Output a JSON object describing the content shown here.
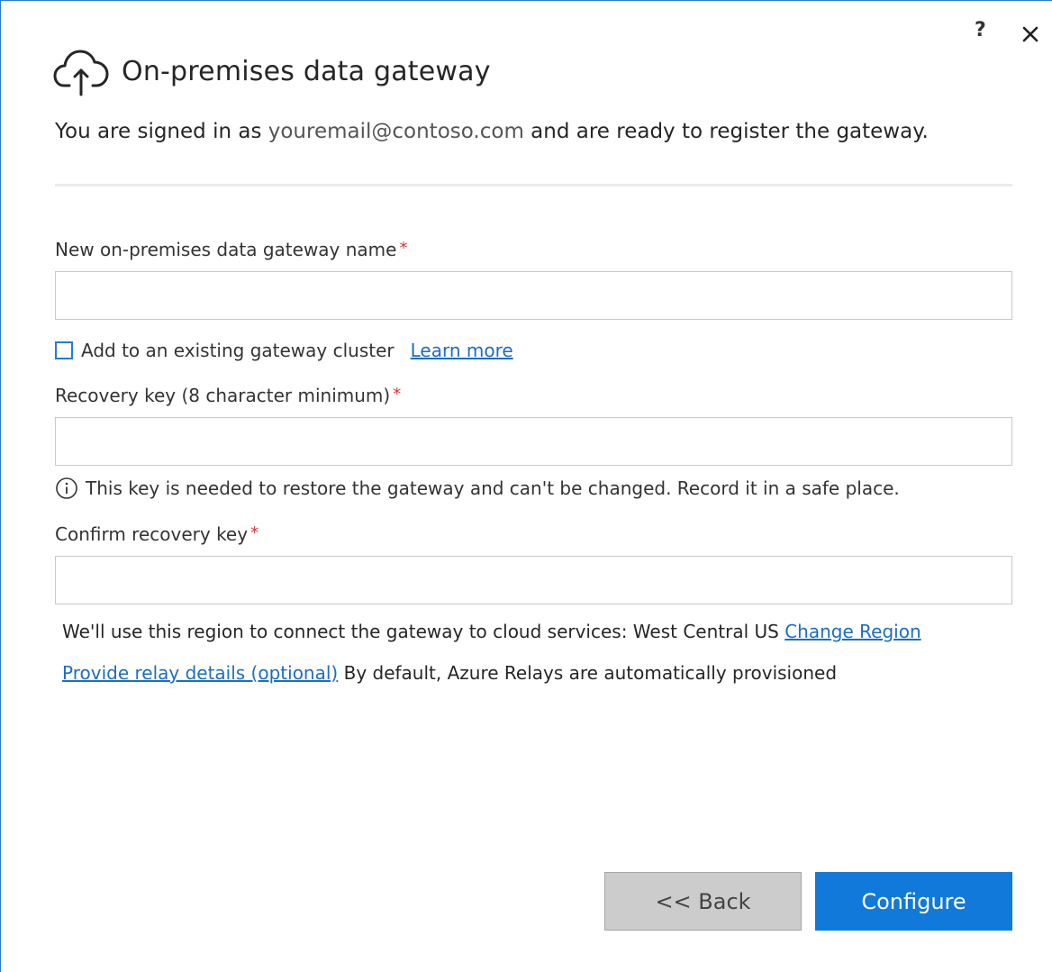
{
  "window": {
    "help_label": "?",
    "title": "On-premises data gateway"
  },
  "intro": {
    "prefix": "You are signed in as ",
    "email": "youremail@contoso.com",
    "suffix": " and are ready to register the gateway."
  },
  "form": {
    "gateway_name_label": "New on-premises data gateway name",
    "gateway_name_value": "",
    "required_marker": "*",
    "cluster_checkbox_label": "Add to an existing gateway cluster",
    "cluster_checked": false,
    "learn_more_link": "Learn more",
    "recovery_key_label": "Recovery key (8 character minimum)",
    "recovery_key_value": "",
    "recovery_key_info": "This key is needed to restore the gateway and can't be changed. Record it in a safe place.",
    "confirm_key_label": "Confirm recovery key",
    "confirm_key_value": ""
  },
  "region": {
    "text": "We'll use this region to connect the gateway to cloud services: West Central US",
    "change_link": "Change Region"
  },
  "relay": {
    "link": "Provide relay details (optional)",
    "text": " By default, Azure Relays are automatically provisioned"
  },
  "buttons": {
    "back_label": "<< Back",
    "configure_label": "Configure"
  },
  "colors": {
    "accent": "#1079d9",
    "link": "#1b6ec2",
    "required": "#d13438"
  }
}
